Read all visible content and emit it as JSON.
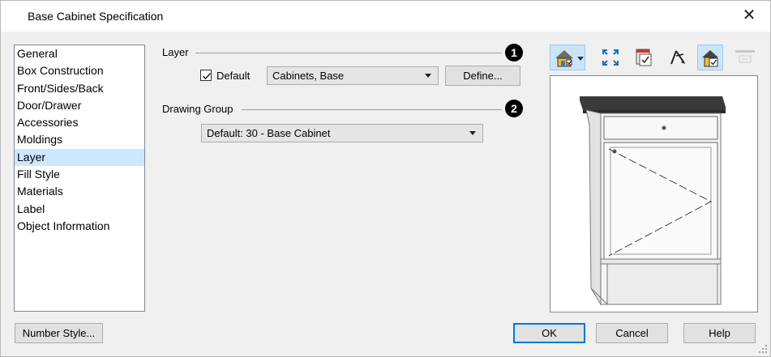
{
  "window": {
    "title": "Base Cabinet Specification",
    "close_glyph": "✕"
  },
  "nav": {
    "items": [
      {
        "label": "General"
      },
      {
        "label": "Box Construction"
      },
      {
        "label": "Front/Sides/Back"
      },
      {
        "label": "Door/Drawer"
      },
      {
        "label": "Accessories"
      },
      {
        "label": "Moldings"
      },
      {
        "label": "Layer",
        "selected": true
      },
      {
        "label": "Fill Style"
      },
      {
        "label": "Materials"
      },
      {
        "label": "Label"
      },
      {
        "label": "Object Information"
      }
    ]
  },
  "layer_group": {
    "label": "Layer",
    "badge": "1",
    "default_checked": true,
    "default_label": "Default",
    "layer_value": "Cabinets,  Base",
    "define_label": "Define..."
  },
  "drawing_group": {
    "label": "Drawing Group",
    "badge": "2",
    "value": "Default: 30 - Base Cabinet"
  },
  "toolbar": {
    "icons": [
      "camera-view-icon",
      "fill-window-icon",
      "show-layers-icon",
      "orbit-icon",
      "render-mode-icon",
      "disabled-tool-icon"
    ]
  },
  "footer": {
    "number_style_label": "Number Style...",
    "ok_label": "OK",
    "cancel_label": "Cancel",
    "help_label": "Help"
  },
  "colors": {
    "selection": "#cce8ff",
    "accent": "#0078d7",
    "countertop": "#3a3a3a"
  }
}
